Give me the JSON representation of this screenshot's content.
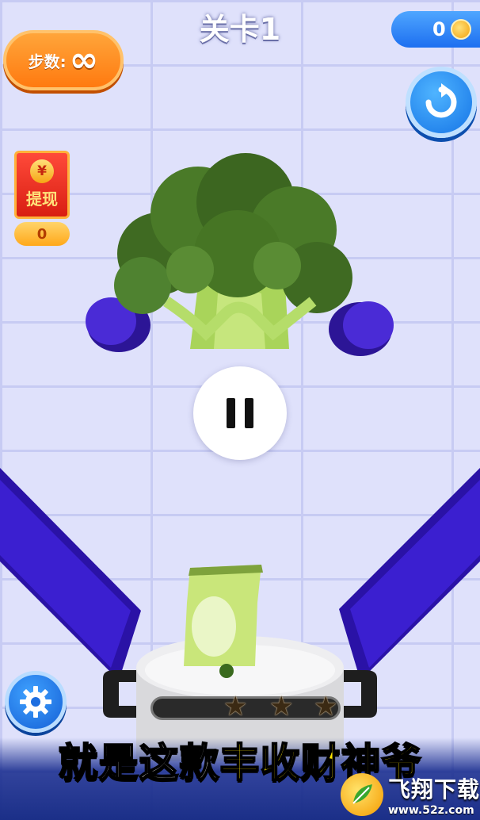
{
  "level": {
    "title": "关卡1"
  },
  "steps": {
    "label": "步数:",
    "value": "∞"
  },
  "coins": {
    "value": "0",
    "icon": "coin-icon"
  },
  "buttons": {
    "reset_icon": "restart-icon",
    "pause_icon": "pause-icon",
    "settings_icon": "gear-icon"
  },
  "red_packet": {
    "symbol": "¥",
    "label": "提现",
    "amount": "0"
  },
  "stars": {
    "earned": 3,
    "total": 3,
    "symbols": [
      "★",
      "★",
      "★"
    ]
  },
  "caption": {
    "part1": "就是这款",
    "part2": "丰收财神爷"
  },
  "watermark": {
    "name": "飞翔下载",
    "url": "www.52z.com"
  },
  "colors": {
    "platform": "#3a1db8",
    "orange_pill": "#ff8a1f",
    "blue_button": "#1d74ea",
    "caption_highlight": "#ffe600"
  }
}
